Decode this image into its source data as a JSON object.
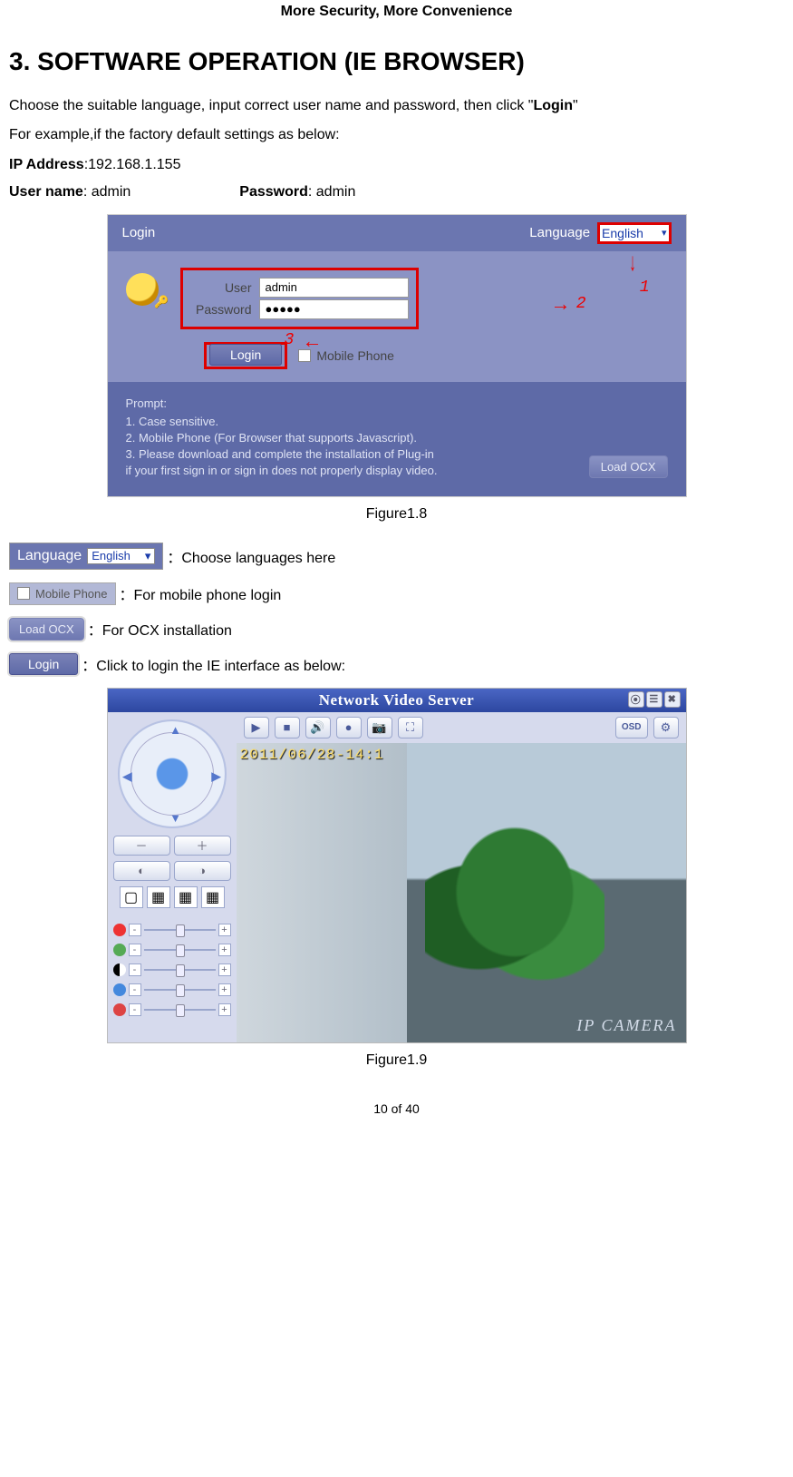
{
  "header": "More Security, More Convenience",
  "h1": "3. SOFTWARE OPERATION (IE BROWSER)",
  "p1_a": "Choose the suitable language, input correct user name and password, then click \"",
  "p1_b": "Login",
  "p1_c": "\"",
  "p2": "For example,if the factory default settings as below:",
  "ip_lbl": "IP Address",
  "ip_val": ":192.168.1.155",
  "user_lbl": "User name",
  "user_val": ": admin",
  "pw_lbl": "Password",
  "pw_val": ": admin",
  "loginbox": {
    "title": "Login",
    "lang_lbl": "Language",
    "lang_val": "English",
    "user_lbl": "User",
    "user_val": "admin",
    "pw_lbl": "Password",
    "pw_val": "●●●●●",
    "login_btn": "Login",
    "mobile": "Mobile Phone",
    "m1": "1",
    "m2": "2",
    "m3": "3",
    "prompt": "Prompt:",
    "l1": "1. Case sensitive.",
    "l2": "2. Mobile Phone (For Browser that supports Javascript).",
    "l3": "3. Please download and complete the installation of Plug-in",
    "l4": "   if your first sign in or sign in does not properly display video.",
    "ocx": "Load OCX"
  },
  "cap1": "Figure1.8",
  "legend": {
    "lang_desc": "：Choose languages here",
    "mobile_desc": "：For mobile phone login",
    "ocx_desc": "：For OCX installation",
    "login_desc": "：Click to login the IE interface as below:"
  },
  "viewer": {
    "title": "Network Video Server",
    "timestamp": "2011/06/28-14:1",
    "watermark": "IP CAMERA",
    "osd": "OSD"
  },
  "cap2": "Figure1.9",
  "footer": "10 of 40"
}
